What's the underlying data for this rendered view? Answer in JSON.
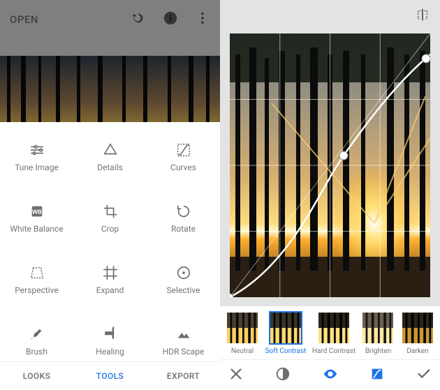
{
  "left_header": {
    "open_label": "OPEN",
    "icons": [
      "layers-icon",
      "info-icon",
      "more-icon"
    ]
  },
  "tools": {
    "items": [
      {
        "label": "Tune Image",
        "icon": "tune"
      },
      {
        "label": "Details",
        "icon": "details"
      },
      {
        "label": "Curves",
        "icon": "curves"
      },
      {
        "label": "White Balance",
        "icon": "wb"
      },
      {
        "label": "Crop",
        "icon": "crop"
      },
      {
        "label": "Rotate",
        "icon": "rotate"
      },
      {
        "label": "Perspective",
        "icon": "perspective"
      },
      {
        "label": "Expand",
        "icon": "expand"
      },
      {
        "label": "Selective",
        "icon": "selective"
      },
      {
        "label": "Brush",
        "icon": "brush"
      },
      {
        "label": "Healing",
        "icon": "healing"
      },
      {
        "label": "HDR Scape",
        "icon": "hdr"
      }
    ]
  },
  "bottom_left": {
    "tabs": [
      {
        "label": "LOOKS",
        "active": false
      },
      {
        "label": "TOOLS",
        "active": true
      },
      {
        "label": "EXPORT",
        "active": false
      }
    ]
  },
  "right_header": {
    "icon": "compare-flip"
  },
  "presets": [
    {
      "label": "Neutral",
      "selected": false
    },
    {
      "label": "Soft Contrast",
      "selected": true
    },
    {
      "label": "Hard Contrast",
      "selected": false
    },
    {
      "label": "Brighten",
      "selected": false
    },
    {
      "label": "Darken",
      "selected": false
    }
  ],
  "right_actions": [
    "cancel",
    "contrast-channel",
    "eye-toggle",
    "histogram-card",
    "apply"
  ]
}
